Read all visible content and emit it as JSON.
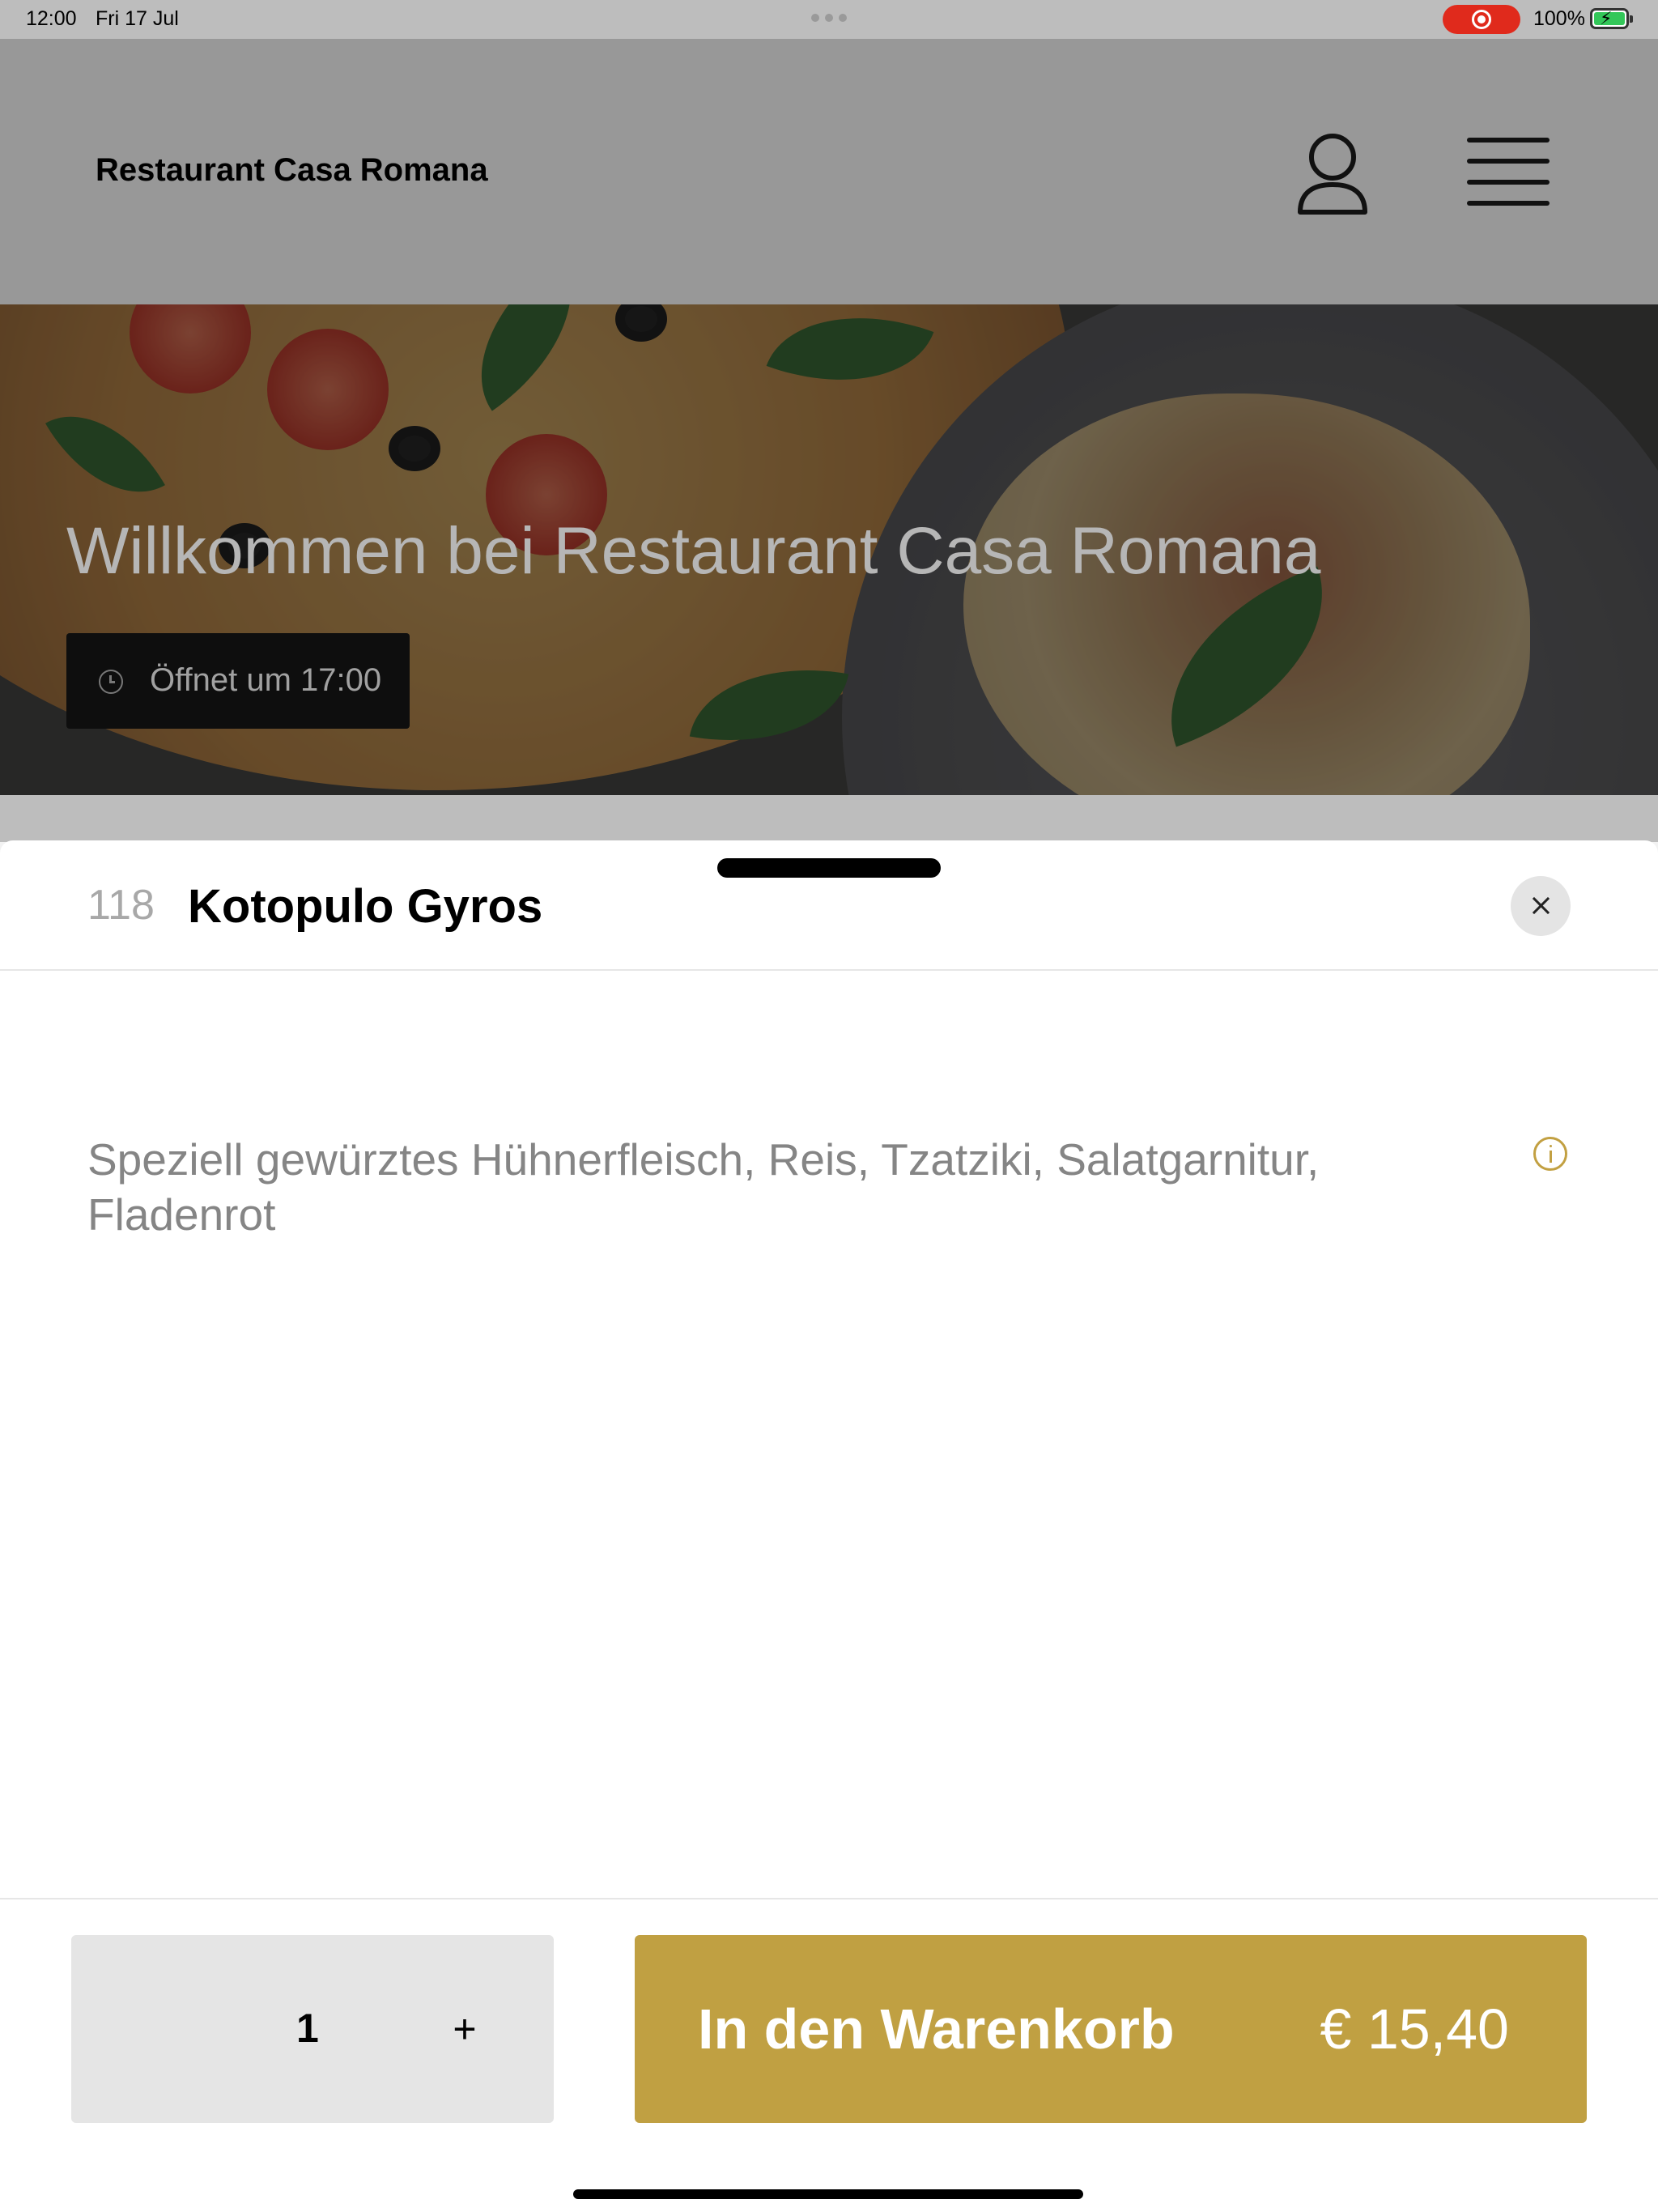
{
  "status_bar": {
    "time": "12:00",
    "date": "Fri 17 Jul",
    "battery": "100%"
  },
  "header": {
    "brand": "Restaurant Casa Romana",
    "icons": [
      "user-icon",
      "menu-icon"
    ]
  },
  "hero": {
    "title": "Willkommen bei Restaurant Casa Romana",
    "open_label": "Öffnet um 17:00"
  },
  "sheet": {
    "item_number": "118",
    "item_name": "Kotopulo Gyros",
    "description": "Speziell gewürztes Hühnerfleisch, Reis, Tzatziki, Salatgarnitur, Fladenrot",
    "quantity": "1",
    "plus_label": "+",
    "cart_label": "In den Warenkorb",
    "price": "€ 15,40"
  },
  "colors": {
    "accent": "#c0a042",
    "recording": "#e02a1c"
  }
}
